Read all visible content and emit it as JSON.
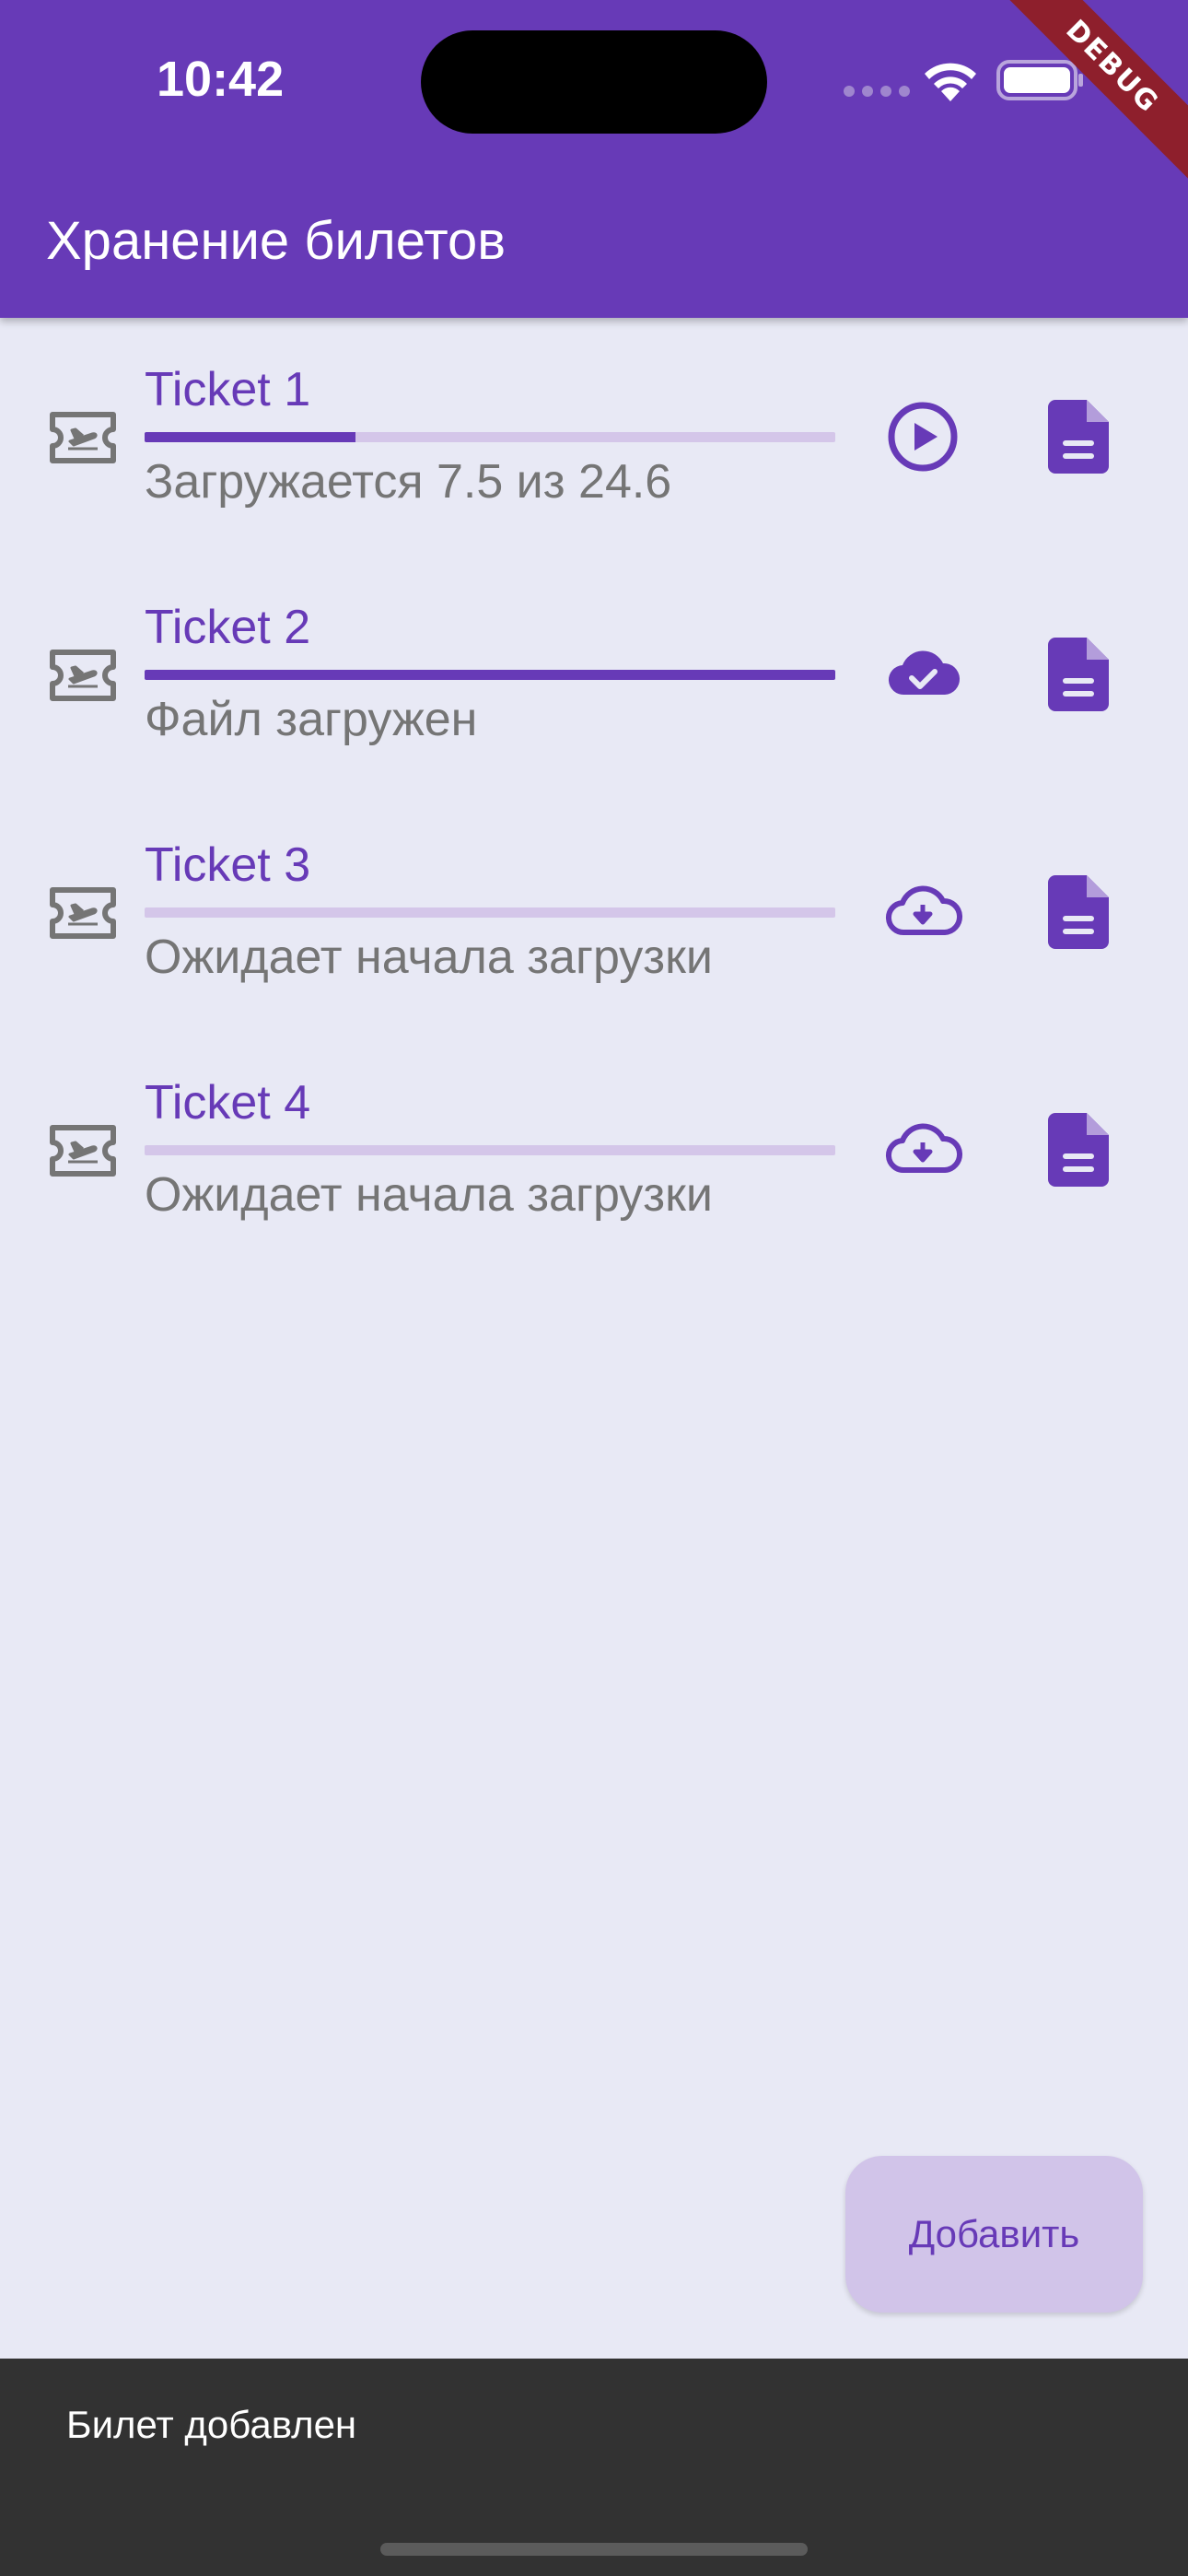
{
  "status_bar": {
    "time": "10:42"
  },
  "debug_banner": "DEBUG",
  "app_bar": {
    "title": "Хранение билетов"
  },
  "colors": {
    "primary": "#673AB7",
    "track": "#D4C6E9",
    "background": "#E8E9F5",
    "snackbar": "#323232"
  },
  "tickets": [
    {
      "title": "Ticket 1",
      "status": "Загружается 7.5 из 24.6",
      "progress": 0.305,
      "action_icon": "play-circle-icon",
      "file_icon": "file-document-icon",
      "leading_icon": "airplane-ticket-icon"
    },
    {
      "title": "Ticket 2",
      "status": "Файл загружен",
      "progress": 1.0,
      "action_icon": "cloud-done-icon",
      "file_icon": "file-document-icon",
      "leading_icon": "airplane-ticket-icon"
    },
    {
      "title": "Ticket 3",
      "status": "Ожидает начала загрузки",
      "progress": 0.0,
      "action_icon": "cloud-download-icon",
      "file_icon": "file-document-icon",
      "leading_icon": "airplane-ticket-icon"
    },
    {
      "title": "Ticket 4",
      "status": "Ожидает начала загрузки",
      "progress": 0.0,
      "action_icon": "cloud-download-icon",
      "file_icon": "file-document-icon",
      "leading_icon": "airplane-ticket-icon"
    }
  ],
  "fab": {
    "label": "Добавить"
  },
  "snackbar": {
    "message": "Билет добавлен"
  }
}
